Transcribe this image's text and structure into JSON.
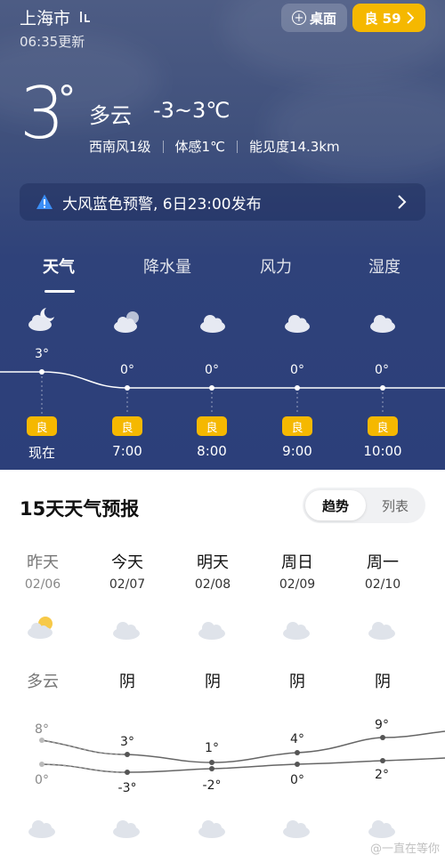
{
  "header": {
    "city": "上海市",
    "updated": "06:35更新",
    "desktop_button": "桌面",
    "aqi_button": "良 59"
  },
  "current": {
    "temp": "3",
    "deg": "°",
    "condition": "多云",
    "range": "-3~3℃",
    "wind": "西南风1级",
    "feels": "体感1℃",
    "visibility": "能见度14.3km"
  },
  "alert": {
    "text": "大风蓝色预警, 6日23:00发布"
  },
  "tabs": [
    "天气",
    "降水量",
    "风力",
    "湿度"
  ],
  "hourly": [
    {
      "time": "现在",
      "temp": "3°",
      "aqi": "良",
      "icon": "cloudy-night-icon"
    },
    {
      "time": "7:00",
      "temp": "0°",
      "aqi": "良",
      "icon": "cloudy-icon"
    },
    {
      "time": "8:00",
      "temp": "0°",
      "aqi": "良",
      "icon": "cloud-icon"
    },
    {
      "time": "9:00",
      "temp": "0°",
      "aqi": "良",
      "icon": "cloud-icon"
    },
    {
      "time": "10:00",
      "temp": "0°",
      "aqi": "良",
      "icon": "cloud-icon"
    }
  ],
  "forecast": {
    "title": "15天天气预报",
    "toggle_trend": "趋势",
    "toggle_list": "列表",
    "days": [
      {
        "name": "昨天",
        "date": "02/06",
        "cond": "多云",
        "high": "8°",
        "low": "0°",
        "icon": "partly-cloudy-icon"
      },
      {
        "name": "今天",
        "date": "02/07",
        "cond": "阴",
        "high": "3°",
        "low": "-3°",
        "icon": "overcast-icon"
      },
      {
        "name": "明天",
        "date": "02/08",
        "cond": "阴",
        "high": "1°",
        "low": "-2°",
        "icon": "overcast-icon"
      },
      {
        "name": "周日",
        "date": "02/09",
        "cond": "阴",
        "high": "4°",
        "low": "0°",
        "icon": "overcast-icon"
      },
      {
        "name": "周一",
        "date": "02/10",
        "cond": "阴",
        "high": "9°",
        "low": "2°",
        "icon": "overcast-icon"
      }
    ]
  },
  "watermark": "@一直在等你",
  "colors": {
    "accent": "#f5b800",
    "sky_top": "#4d5c84",
    "sky_bottom": "#2c3f7a"
  }
}
